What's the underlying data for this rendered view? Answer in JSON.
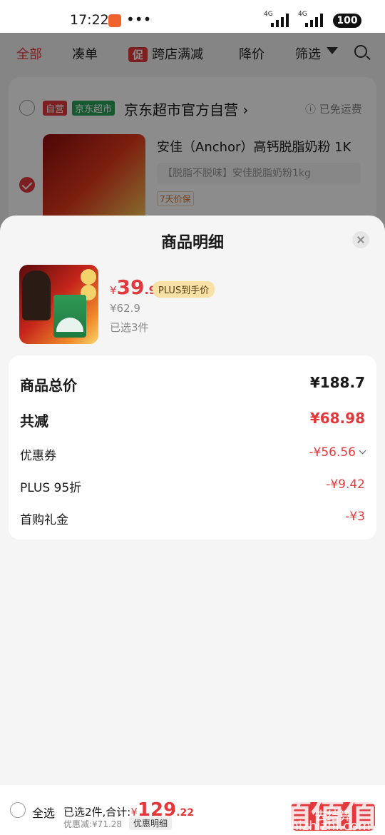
{
  "status_bar": {
    "time": "17:22",
    "dots": "•••",
    "net1": "4G",
    "net2": "4G",
    "battery": "100"
  },
  "tabs": [
    {
      "label": "全部",
      "active": true
    },
    {
      "label": "凑单"
    },
    {
      "label": "跨店满减",
      "tag": "促"
    },
    {
      "label": "降价"
    },
    {
      "label": "筛选"
    }
  ],
  "shop": {
    "self_badge": "自营",
    "market_badge": "京东超市",
    "name": "京东超市官方自营",
    "chevron": "›",
    "shipping": "ⓘ 已免运费"
  },
  "cart_item": {
    "title": "安佳（Anchor）高钙脱脂奶粉 1K",
    "spec": "【脱脂不脱味】安佳脱脂奶粉1kg",
    "tag": "7天价保"
  },
  "sheet": {
    "title": "商品明细",
    "product": {
      "price_symbol": "¥",
      "price_int": "39",
      "price_dec": ".9",
      "plus_tag": "PLUS到手价",
      "original_price": "¥62.9",
      "selected_qty": "已选3件"
    },
    "summary": {
      "total_label": "商品总价",
      "total_value": "¥188.7",
      "reduced_label": "共减",
      "reduced_value": "¥68.98",
      "items": [
        {
          "label": "优惠券",
          "value": "-¥56.56",
          "expandable": true
        },
        {
          "label": "PLUS 95折",
          "value": "-¥9.42"
        },
        {
          "label": "首购礼金",
          "value": "-¥3"
        }
      ]
    }
  },
  "bottom_bar": {
    "select_all": "全选",
    "selected_summary": "已选2件,合计:",
    "total_symbol": "¥",
    "total_int": "129",
    "total_dec": ".22",
    "discount": "优惠减:¥71.28",
    "detail_button": "优惠明细",
    "checkout": "去结算",
    "watermark": "值值值",
    "watermark_url": "zhizhizhi.com"
  },
  "colors": {
    "accent_red": "#e4393c",
    "plus_gold": "#f7e1a6",
    "market_green": "#29a35a"
  }
}
